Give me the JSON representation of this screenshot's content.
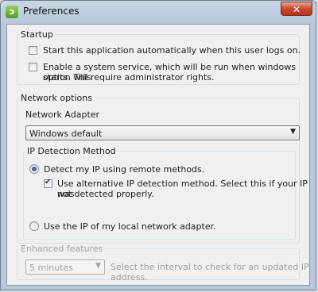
{
  "window": {
    "title": "Preferences",
    "close_label": "✕",
    "app_icon_glyph": "ɔ"
  },
  "startup": {
    "legend": "Startup",
    "start_auto": {
      "label": "Start this application automatically when this user logs on.",
      "checked": false
    },
    "system_service": {
      "label_line1": "Enable a system service, which will be run when windows starts. This",
      "label_line2": "option will require administrator rights.",
      "checked": false
    }
  },
  "network": {
    "legend": "Network options",
    "adapter_label": "Network Adapter",
    "adapter_selected": "Windows default",
    "ip_detection": {
      "legend": "IP Detection Method",
      "remote": {
        "label": "Detect my IP using remote methods.",
        "selected": true
      },
      "alternative": {
        "label_line1": "Use alternative IP detection method. Select this if your IP was",
        "label_line2": "not detected properly.",
        "checked": true
      },
      "local": {
        "label": "Use the IP of my local network adapter.",
        "selected": false
      }
    }
  },
  "enhanced": {
    "legend": "Enhanced features",
    "interval_selected": "5 minutes",
    "interval_hint": "Select the interval to check for an updated IP address.",
    "disabled": true
  },
  "colors": {
    "titlebar": "#c9d7e6",
    "client_bg": "#f0f0f0",
    "close_red": "#c9492d",
    "disabled_text": "#a0a0a0"
  }
}
